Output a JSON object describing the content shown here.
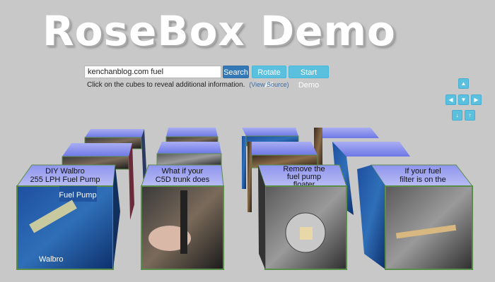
{
  "title": "RoseBox Demo",
  "search": {
    "value": "kenchanblog.com fuel"
  },
  "buttons": {
    "search": "Search",
    "rotate_all": "Rotate All",
    "start_demo": "Start Demo"
  },
  "info": {
    "text": "Click on the cubes to reveal additional information.",
    "link": "(View Source)"
  },
  "controls": {
    "up": "▲",
    "left": "◀",
    "down": "▼",
    "right": "▶",
    "move_down": "↓",
    "move_up": "↑"
  },
  "cubes": {
    "front": [
      {
        "label1": "DIY Walbro",
        "label2": "255 LPH Fuel Pump"
      },
      {
        "label1": "What if your",
        "label2": "C5D trunk does"
      },
      {
        "label1": "Remove the",
        "label2": "fuel pump",
        "label3": "floater"
      },
      {
        "label1": "If your fuel",
        "label2": "filter is on the"
      }
    ],
    "pump_caption": "Fuel Pump",
    "walbro_caption": "Walbro"
  },
  "colors": {
    "button_primary": "#3379b7",
    "button_info": "#5bc0de",
    "cube_top": "#7b83e8",
    "cube_border": "#5a8c4a"
  }
}
